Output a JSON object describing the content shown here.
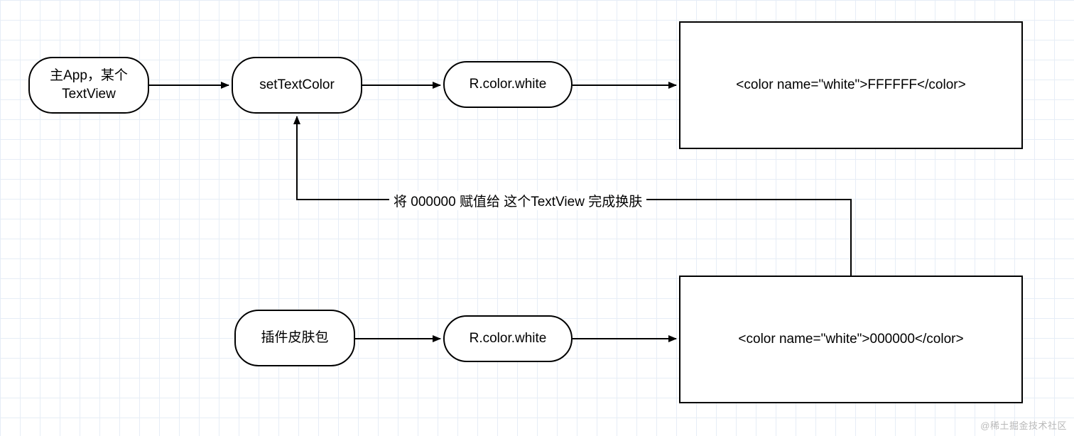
{
  "nodes": {
    "main_app": {
      "label": "主App，某个\nTextView"
    },
    "set_color": {
      "label": "setTextColor"
    },
    "r_white_1": {
      "label": "R.color.white"
    },
    "xml_white": {
      "label": "<color name=\"white\">FFFFFF</color>"
    },
    "plugin_pack": {
      "label": "插件皮肤包"
    },
    "r_white_2": {
      "label": "R.color.white"
    },
    "xml_black": {
      "label": "<color name=\"white\">000000</color>"
    }
  },
  "annotation": {
    "feedback": "将 000000 赋值给 这个TextView 完成换肤"
  },
  "watermark": "@稀土掘金技术社区",
  "chart_data": {
    "type": "diagram",
    "title": "",
    "nodes": [
      {
        "id": "main_app",
        "label": "主App，某个 TextView",
        "shape": "rounded-rect"
      },
      {
        "id": "set_color",
        "label": "setTextColor",
        "shape": "rounded-rect"
      },
      {
        "id": "r_white_1",
        "label": "R.color.white",
        "shape": "rounded-rect"
      },
      {
        "id": "xml_white",
        "label": "<color name=\"white\">FFFFFF</color>",
        "shape": "rect"
      },
      {
        "id": "plugin_pack",
        "label": "插件皮肤包",
        "shape": "rounded-rect"
      },
      {
        "id": "r_white_2",
        "label": "R.color.white",
        "shape": "rounded-rect"
      },
      {
        "id": "xml_black",
        "label": "<color name=\"white\">000000</color>",
        "shape": "rect"
      }
    ],
    "edges": [
      {
        "from": "main_app",
        "to": "set_color"
      },
      {
        "from": "set_color",
        "to": "r_white_1"
      },
      {
        "from": "r_white_1",
        "to": "xml_white"
      },
      {
        "from": "plugin_pack",
        "to": "r_white_2"
      },
      {
        "from": "r_white_2",
        "to": "xml_black"
      },
      {
        "from": "xml_black",
        "to": "set_color",
        "label": "将 000000 赋值给 这个TextView 完成换肤"
      }
    ]
  }
}
